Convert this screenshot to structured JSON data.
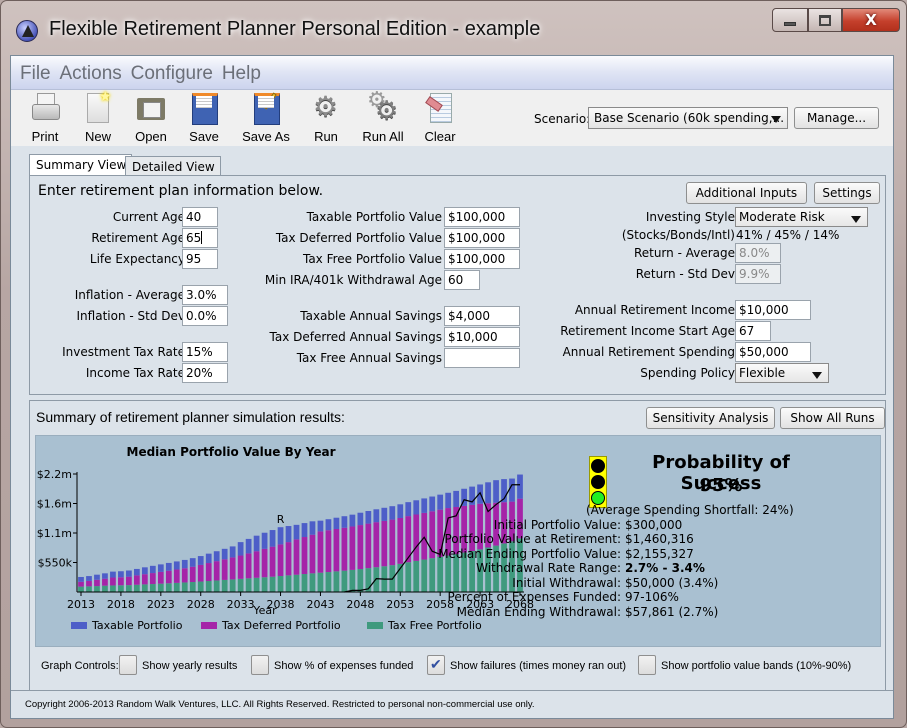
{
  "window": {
    "title": "Flexible Retirement Planner Personal Edition - example",
    "controls": {
      "minimize": "minimize",
      "maximize": "maximize",
      "close": "X"
    }
  },
  "menu": [
    "File",
    "Actions",
    "Configure",
    "Help"
  ],
  "toolbar": {
    "items": [
      {
        "label": "Print",
        "icon": "printer-icon"
      },
      {
        "label": "New",
        "icon": "new-file-icon"
      },
      {
        "label": "Open",
        "icon": "folder-open-icon"
      },
      {
        "label": "Save",
        "icon": "floppy-disk-icon"
      },
      {
        "label": "Save As",
        "icon": "floppy-disk-pencil-icon"
      },
      {
        "label": "Run",
        "icon": "gear-icon"
      },
      {
        "label": "Run All",
        "icon": "gears-icon"
      },
      {
        "label": "Clear",
        "icon": "eraser-document-icon"
      }
    ],
    "scenario_label": "Scenario:",
    "scenario_value": "Base Scenario (60k spending,...",
    "manage_label": "Manage..."
  },
  "tabs": [
    {
      "label": "Summary View",
      "active": true
    },
    {
      "label": "Detailed View",
      "active": false
    }
  ],
  "inputs_panel": {
    "intro": "Enter retirement plan information below.",
    "additional_inputs_label": "Additional Inputs",
    "settings_label": "Settings",
    "col1": [
      {
        "label": "Current Age",
        "value": "40"
      },
      {
        "label": "Retirement Age",
        "value": "65"
      },
      {
        "label": "Life Expectancy",
        "value": "95"
      },
      {
        "label": "Inflation - Average",
        "value": "3.0%"
      },
      {
        "label": "Inflation - Std Dev",
        "value": "0.0%"
      },
      {
        "label": "Investment Tax Rate",
        "value": "15%"
      },
      {
        "label": "Income Tax Rate",
        "value": "20%"
      }
    ],
    "col2": [
      {
        "label": "Taxable Portfolio Value",
        "value": "$100,000"
      },
      {
        "label": "Tax Deferred Portfolio Value",
        "value": "$100,000"
      },
      {
        "label": "Tax Free Portfolio Value",
        "value": "$100,000"
      },
      {
        "label": "Min IRA/401k Withdrawal Age",
        "value": "60"
      },
      {
        "label": "Taxable Annual Savings",
        "value": "$4,000"
      },
      {
        "label": "Tax Deferred Annual Savings",
        "value": "$10,000"
      },
      {
        "label": "Tax Free Annual Savings",
        "value": ""
      }
    ],
    "col3": {
      "investing_style_label": "Investing Style",
      "investing_style_value": "Moderate Risk",
      "allocation_label": "(Stocks/Bonds/Intl)",
      "allocation_value": "41% / 45% / 14%",
      "return_avg_label": "Return - Average",
      "return_avg_value": "8.0%",
      "return_std_label": "Return - Std Dev",
      "return_std_value": "9.9%",
      "annual_income_label": "Annual Retirement Income",
      "annual_income_value": "$10,000",
      "income_start_label": "Retirement Income Start Age",
      "income_start_value": "67",
      "annual_spending_label": "Annual Retirement Spending",
      "annual_spending_value": "$50,000",
      "spending_policy_label": "Spending Policy",
      "spending_policy_value": "Flexible"
    }
  },
  "results_panel": {
    "title": "Summary of retirement planner simulation results:",
    "sensitivity_label": "Sensitivity Analysis",
    "show_all_runs_label": "Show All Runs",
    "probability_title": "Probability of Success",
    "probability_value": "95%",
    "traffic_light": "green",
    "stats": [
      {
        "label": "",
        "value": "(Average Spending Shortfall: 24%)",
        "bold": false
      },
      {
        "label": "Initial Portfolio Value:",
        "value": "$300,000",
        "bold": false
      },
      {
        "label": "Portfolio Value at Retirement:",
        "value": "$1,460,316",
        "bold": false
      },
      {
        "label": "Median Ending Portfolio Value:",
        "value": "$2,155,327",
        "bold": false
      },
      {
        "label": "Withdrawal Rate Range:",
        "value": "2.7% - 3.4%",
        "bold": true
      },
      {
        "label": "Initial Withdrawal:",
        "value": "$50,000 (3.4%)",
        "bold": false
      },
      {
        "label": "Percent of Expenses Funded:",
        "value": "97-106%",
        "bold": false
      },
      {
        "label": "Median Ending Withdrawal:",
        "value": "$57,861 (2.7%)",
        "bold": false
      }
    ],
    "graph_controls_label": "Graph Controls:",
    "graph_controls": [
      {
        "label": "Show yearly results",
        "checked": false
      },
      {
        "label": "Show % of expenses funded",
        "checked": false
      },
      {
        "label": "Show failures (times money ran out)",
        "checked": true
      },
      {
        "label": "Show portfolio value bands (10%-90%)",
        "checked": false
      }
    ]
  },
  "footer": "Copyright 2006-2013 Random Walk Ventures, LLC.  All Rights Reserved.  Restricted to personal non-commercial use only.",
  "chart_data": {
    "type": "bar",
    "stacked": true,
    "title": "Median Portfolio Value By Year",
    "xlabel": "Year",
    "ylabel": "",
    "x_ticks": [
      "2013",
      "2018",
      "2023",
      "2028",
      "2033",
      "2038",
      "2043",
      "2048",
      "2053",
      "2058",
      "2063",
      "2068"
    ],
    "y_ticks": [
      "$550k",
      "$1.1m",
      "$1.6m",
      "$2.2m"
    ],
    "y_tick_values": [
      550,
      1100,
      1650,
      2200
    ],
    "ylim": [
      0,
      2200
    ],
    "units": "thousands of dollars",
    "retirement_marker": {
      "label": "R",
      "year": 2038
    },
    "legend_position": "bottom",
    "categories": [
      2013,
      2014,
      2015,
      2016,
      2017,
      2018,
      2019,
      2020,
      2021,
      2022,
      2023,
      2024,
      2025,
      2026,
      2027,
      2028,
      2029,
      2030,
      2031,
      2032,
      2033,
      2034,
      2035,
      2036,
      2037,
      2038,
      2039,
      2040,
      2041,
      2042,
      2043,
      2044,
      2045,
      2046,
      2047,
      2048,
      2049,
      2050,
      2051,
      2052,
      2053,
      2054,
      2055,
      2056,
      2057,
      2058,
      2059,
      2060,
      2061,
      2062,
      2063,
      2064,
      2065,
      2066,
      2067,
      2068
    ],
    "series": [
      {
        "name": "Tax Free Portfolio",
        "color": "#3f9a7e",
        "values": [
          100,
          105,
          110,
          118,
          122,
          125,
          128,
          135,
          142,
          148,
          155,
          162,
          170,
          178,
          186,
          195,
          205,
          215,
          225,
          235,
          245,
          255,
          265,
          275,
          285,
          298,
          310,
          322,
          335,
          348,
          360,
          372,
          385,
          398,
          412,
          428,
          445,
          462,
          480,
          500,
          525,
          555,
          580,
          605,
          630,
          655,
          680,
          705,
          735,
          765,
          795,
          830,
          865,
          905,
          945,
          1000
        ]
      },
      {
        "name": "Tax Deferred Portfolio",
        "color": "#a524a8",
        "values": [
          90,
          102,
          118,
          130,
          148,
          150,
          158,
          175,
          190,
          205,
          220,
          235,
          250,
          265,
          285,
          310,
          335,
          360,
          385,
          410,
          435,
          465,
          495,
          530,
          560,
          590,
          620,
          660,
          690,
          720,
          770,
          780,
          790,
          800,
          810,
          820,
          830,
          840,
          845,
          850,
          855,
          860,
          865,
          870,
          875,
          880,
          885,
          880,
          870,
          860,
          850,
          825,
          800,
          770,
          740,
          740
        ]
      },
      {
        "name": "Taxable Portfolio",
        "color": "#4d5ec8",
        "values": [
          90,
          90,
          95,
          100,
          110,
          112,
          115,
          120,
          128,
          135,
          140,
          145,
          150,
          155,
          160,
          165,
          175,
          185,
          195,
          205,
          250,
          270,
          290,
          300,
          310,
          320,
          300,
          270,
          260,
          250,
          200,
          205,
          210,
          215,
          220,
          230,
          235,
          240,
          245,
          250,
          255,
          260,
          265,
          270,
          275,
          280,
          285,
          300,
          320,
          340,
          360,
          390,
          420,
          430,
          430,
          450
        ]
      }
    ],
    "failures_line": {
      "name": "Failures (times money ran out)",
      "color": "#000000",
      "points": [
        [
          2046,
          0
        ],
        [
          2047,
          30
        ],
        [
          2048,
          30
        ],
        [
          2049,
          60
        ],
        [
          2050,
          250
        ],
        [
          2051,
          240
        ],
        [
          2052,
          240
        ],
        [
          2053,
          440
        ],
        [
          2054,
          640
        ],
        [
          2055,
          840
        ],
        [
          2056,
          1020
        ],
        [
          2057,
          760
        ],
        [
          2058,
          700
        ],
        [
          2059,
          1380
        ],
        [
          2060,
          1420
        ],
        [
          2061,
          1720
        ],
        [
          2062,
          1680
        ],
        [
          2063,
          1850
        ],
        [
          2064,
          1500
        ],
        [
          2065,
          1630
        ],
        [
          2066,
          1740
        ],
        [
          2067,
          2000
        ],
        [
          2068,
          2000
        ]
      ]
    }
  }
}
